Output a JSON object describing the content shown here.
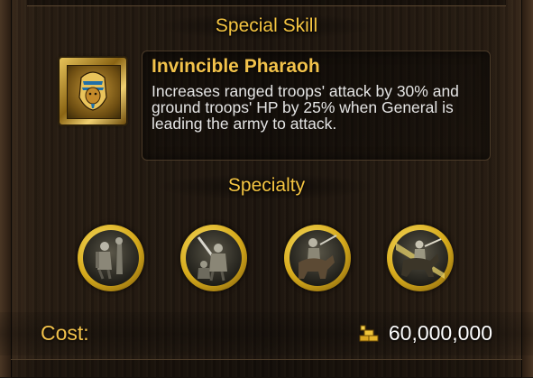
{
  "special_skill": {
    "section_title": "Special Skill",
    "name": "Invincible Pharaoh",
    "description": "Increases ranged troops' attack by 30% and ground troops' HP by 25% when General is leading the army to attack.",
    "icon": "pharaoh-icon"
  },
  "specialty": {
    "section_title": "Specialty",
    "items": [
      {
        "icon": "infantry-icon"
      },
      {
        "icon": "swordsman-icon"
      },
      {
        "icon": "cavalry-icon"
      },
      {
        "icon": "charging-cavalry-icon"
      }
    ]
  },
  "cost": {
    "label": "Cost:",
    "value": "60,000,000",
    "icon": "gold-icon"
  },
  "colors": {
    "title_gold": "#f5c542",
    "text": "#e4e4e4",
    "background": "#1b150f"
  }
}
